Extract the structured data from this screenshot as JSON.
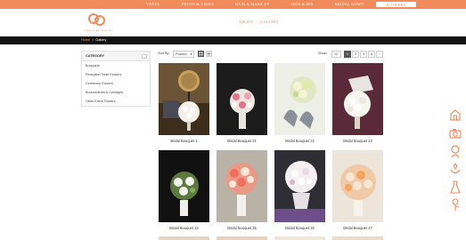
{
  "topnav": {
    "items": [
      "VENUE",
      "PHOTO & VIDEO",
      "HAIR & MAKE UP",
      "SKIN & SPA",
      "BRIDAL GOWN",
      "FLOWERS"
    ],
    "active": "FLOWERS"
  },
  "logo": {
    "text": "Chérie Promotions"
  },
  "subnav": {
    "about": "ABOUT",
    "gallery": "GALLERY"
  },
  "breadcrumb": {
    "home": "Home",
    "separator": ">",
    "current": "Gallery"
  },
  "sidebar": {
    "heading": "CATEGORY",
    "collapse": "-",
    "items": [
      "Bouquets",
      "Reception Table Flowers",
      "Ceremony Flowers",
      "Boutonnieres & Corsages",
      "Other Event Flowers"
    ]
  },
  "toolbar": {
    "sort_label": "Sort By:",
    "sort_value": "Position",
    "show_label": "Show:",
    "show_value": "12",
    "pages": [
      "1",
      "2",
      "3",
      "4"
    ],
    "current_page": "1",
    "next": "›"
  },
  "products": [
    {
      "name": "Bridal Bouquet 1"
    },
    {
      "name": "Bridal Bouquet 21"
    },
    {
      "name": "Bridal Bouquet 22"
    },
    {
      "name": "Bridal Bouquet 23"
    },
    {
      "name": "Bridal Bouquet 24"
    },
    {
      "name": "Bridal Bouquet 25"
    },
    {
      "name": "Bridal Bouquet 26"
    },
    {
      "name": "Bridal Bouquet 27"
    }
  ],
  "side_icons": [
    "venue-icon",
    "camera-icon",
    "makeup-icon",
    "spa-icon",
    "gown-icon",
    "flower-icon"
  ],
  "colors": {
    "accent": "#f28b5b",
    "dark_bar": "#141414"
  }
}
